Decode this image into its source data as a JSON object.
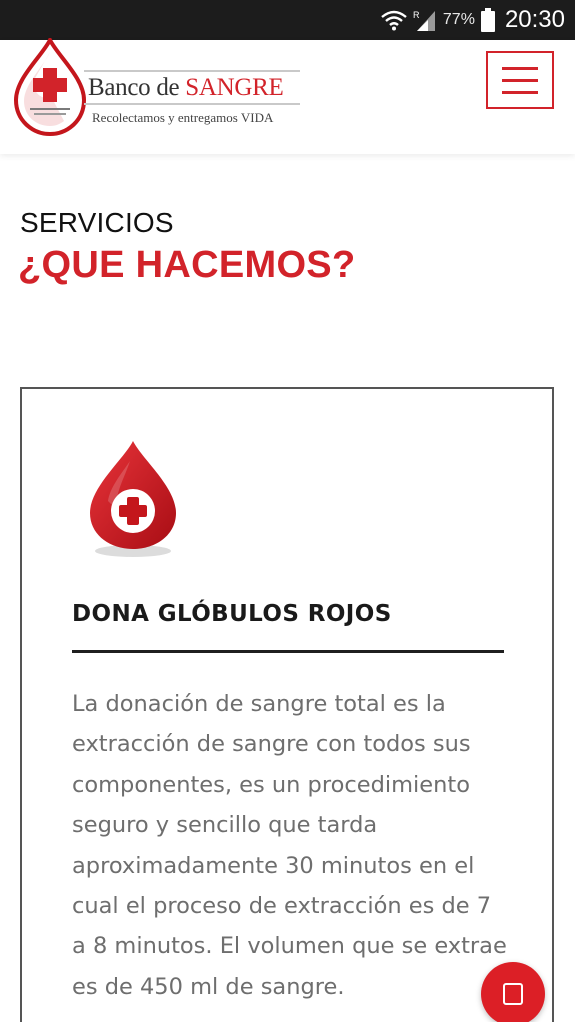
{
  "status_bar": {
    "battery_percent": "77%",
    "time": "20:30",
    "roaming_indicator": "R",
    "icons": [
      "wifi-icon",
      "signal-icon",
      "battery-icon"
    ]
  },
  "header": {
    "brand_prefix": "Banco de ",
    "brand_accent": "SANGRE",
    "tagline": "Recolectamos y entregamos VIDA",
    "logo_icon": "blood-drop-cross-logo",
    "menu_icon": "hamburger-menu-icon"
  },
  "section": {
    "kicker": "SERVICIOS",
    "title": "¿QUE HACEMOS?"
  },
  "service": {
    "icon": "blood-drop-plus-icon",
    "title": "DONA GLÓBULOS ROJOS",
    "description": "La donación de sangre total es la extracción de sangre con todos sus componentes, es un procedimiento seguro y sencillo que tarda aproximadamente 30 minutos en el cual el proceso de extracción es de 7 a 8 minutos. El volumen que se extrae es de 450 ml de sangre."
  },
  "fab": {
    "icon": "square-icon"
  },
  "colors": {
    "brand_red": "#d2232a",
    "status_bar": "#1c1c1c",
    "heading_dark": "#111111",
    "body_text": "#6e6e6e"
  }
}
